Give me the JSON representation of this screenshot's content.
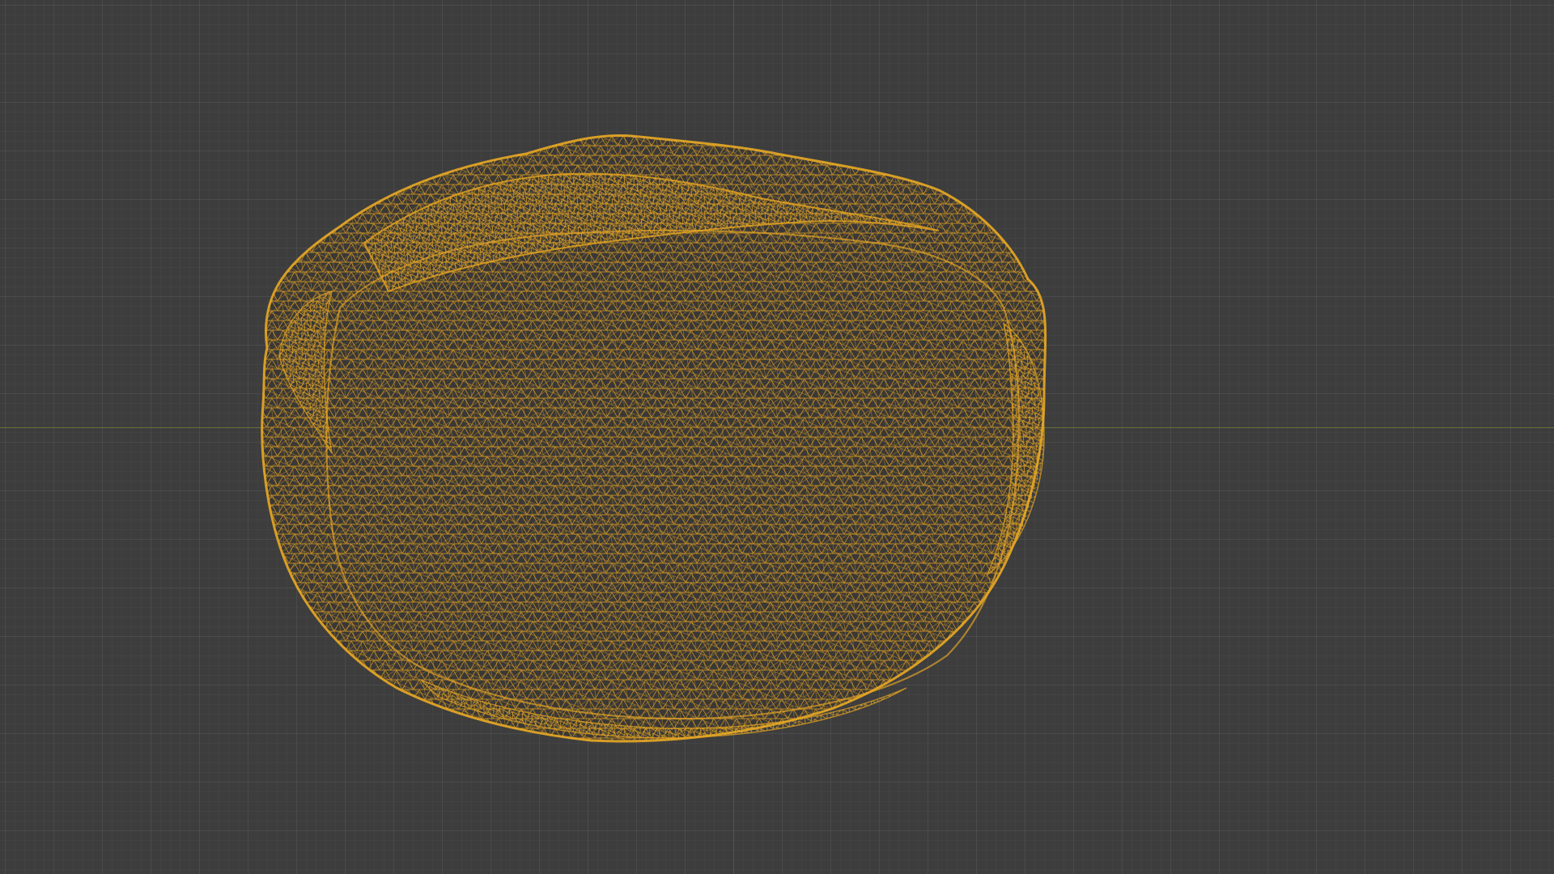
{
  "viewport": {
    "background_color": "#3d3d3d",
    "grid_color": "#4a4a4a",
    "x_axis_color": "#6b7a3a",
    "y_axis_color": "#3f5f7a"
  },
  "object": {
    "type": "wireframe-mesh",
    "shape": "rock",
    "wire_color": "#e0a020",
    "shading": "wireframe"
  }
}
